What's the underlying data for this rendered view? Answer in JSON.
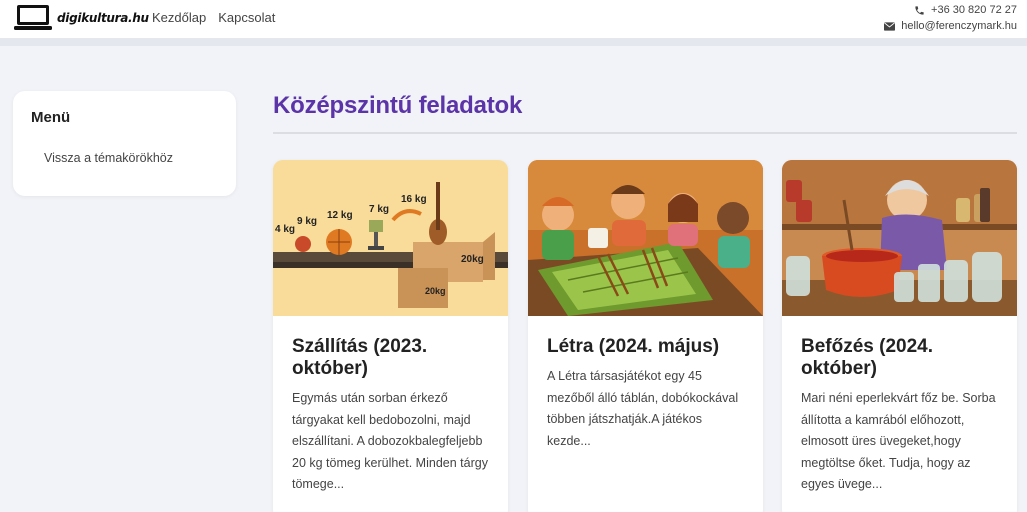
{
  "header": {
    "brand": "digikultura.hu",
    "nav": [
      "Kezdőlap",
      "Kapcsolat"
    ],
    "phone": "+36 30 820 72 27",
    "email": "hello@ferenczymark.hu"
  },
  "sidebar": {
    "title": "Menü",
    "link": "Vissza a témakörökhöz"
  },
  "main": {
    "title": "Középszintű feladatok",
    "cards": [
      {
        "title": "Szállítás (2023. október)",
        "text": "Egymás után sorban érkező tárgyakat kell bedobozolni, majd elszállítani. A dobozokbalegfeljebb 20 kg tömeg kerülhet. Minden tárgy tömege...",
        "image_labels": [
          "4 kg",
          "9 kg",
          "12 kg",
          "7 kg",
          "16 kg",
          "20kg",
          "20kg"
        ]
      },
      {
        "title": "Létra (2024. május)",
        "text": "A Létra társasjátékot egy 45 mezőből álló táblán, dobókockával többen játszhatják.A játékos kezde..."
      },
      {
        "title": "Befőzés (2024. október)",
        "text": "Mari néni eperlekvárt főz be. Sorba állította a kamrából előhozott, elmosott üres üvegeket,hogy megtöltse őket. Tudja, hogy az egyes üvege..."
      }
    ]
  }
}
